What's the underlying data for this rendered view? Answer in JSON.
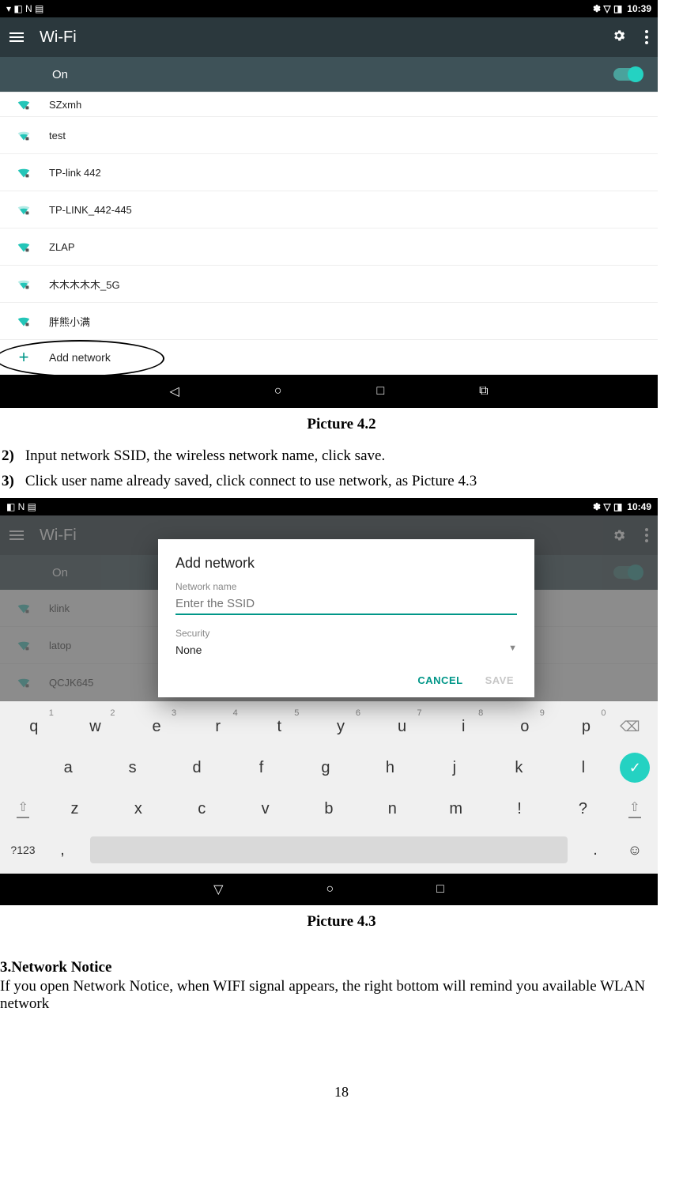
{
  "shot1": {
    "time": "10:39",
    "title": "Wi-Fi",
    "toggle_label": "On",
    "networks": [
      "SZxmh",
      "test",
      "TP-link 442",
      "TP-LINK_442-445",
      "ZLAP",
      "木木木木木_5G",
      "胖熊小满"
    ],
    "add_network": "Add network"
  },
  "caption1": "Picture 4.2",
  "step2": {
    "num": "2)",
    "text": "Input network SSID, the wireless network name, click save."
  },
  "step3": {
    "num": "3)",
    "text": "Click user name already saved, click connect to use network, as Picture 4.3"
  },
  "shot2": {
    "time": "10:49",
    "title": "Wi-Fi",
    "toggle_label": "On",
    "bg_networks": [
      "klink",
      "latop",
      "QCJK645"
    ],
    "dialog": {
      "title": "Add network",
      "name_label": "Network name",
      "placeholder": "Enter the SSID",
      "security_label": "Security",
      "security_value": "None",
      "cancel": "CANCEL",
      "save": "SAVE"
    },
    "keyboard": {
      "row1": [
        {
          "k": "q",
          "n": "1"
        },
        {
          "k": "w",
          "n": "2"
        },
        {
          "k": "e",
          "n": "3"
        },
        {
          "k": "r",
          "n": "4"
        },
        {
          "k": "t",
          "n": "5"
        },
        {
          "k": "y",
          "n": "6"
        },
        {
          "k": "u",
          "n": "7"
        },
        {
          "k": "i",
          "n": "8"
        },
        {
          "k": "o",
          "n": "9"
        },
        {
          "k": "p",
          "n": "0"
        }
      ],
      "row2": [
        "a",
        "s",
        "d",
        "f",
        "g",
        "h",
        "j",
        "k",
        "l"
      ],
      "row3": [
        "z",
        "x",
        "c",
        "v",
        "b",
        "n",
        "m",
        "!",
        "?"
      ],
      "mode_key": "?123"
    }
  },
  "caption2": "Picture 4.3",
  "section3": {
    "title": "3.Network Notice",
    "body": "If you open Network Notice, when WIFI signal appears, the right bottom will remind you available WLAN network"
  },
  "page_number": "18"
}
